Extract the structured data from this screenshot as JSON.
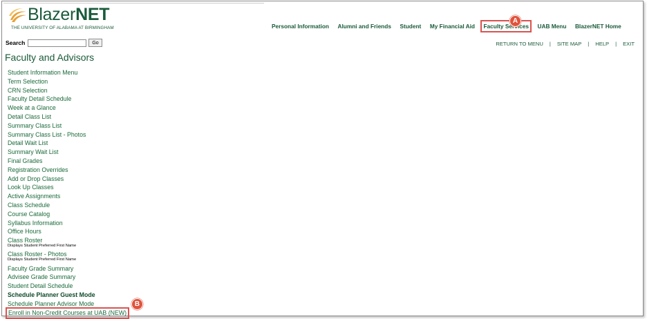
{
  "header": {
    "logo_blazer": "Blazer",
    "logo_net": "NET",
    "logo_sub": "THE UNIVERSITY OF ALABAMA AT BIRMINGHAM",
    "nav": [
      {
        "label": "Personal Information"
      },
      {
        "label": "Alumni and Friends"
      },
      {
        "label": "Student"
      },
      {
        "label": "My Financial Aid"
      },
      {
        "label": "Faculty Services"
      },
      {
        "label": "UAB Menu"
      },
      {
        "label": "BlazerNET Home"
      }
    ],
    "active_nav": "Faculty Services"
  },
  "search": {
    "label": "Search",
    "value": "",
    "go_label": "Go"
  },
  "utility_links": {
    "return": "RETURN TO MENU",
    "sitemap": "SITE MAP",
    "help": "HELP",
    "exit": "EXIT",
    "separator": "|"
  },
  "page": {
    "title": "Faculty and Advisors"
  },
  "menu": [
    {
      "label": "Student Information Menu"
    },
    {
      "label": "Term Selection"
    },
    {
      "label": "CRN Selection"
    },
    {
      "label": "Faculty Detail Schedule"
    },
    {
      "label": "Week at a Glance"
    },
    {
      "label": "Detail Class List"
    },
    {
      "label": "Summary Class List"
    },
    {
      "label": "Summary Class List - Photos"
    },
    {
      "label": "Detail Wait List"
    },
    {
      "label": "Summary Wait List"
    },
    {
      "label": "Final Grades"
    },
    {
      "label": "Registration Overrides"
    },
    {
      "label": "Add or Drop Classes"
    },
    {
      "label": "Look Up Classes"
    },
    {
      "label": "Active Assignments"
    },
    {
      "label": "Class Schedule"
    },
    {
      "label": "Course Catalog"
    },
    {
      "label": "Syllabus Information"
    },
    {
      "label": "Office Hours"
    },
    {
      "label": "Class Roster",
      "sub": "Displays Student Preferred First Name"
    },
    {
      "label": "Class Roster - Photos",
      "sub": "Displays Student Preferred First Name"
    },
    {
      "label": "Faculty Grade Summary"
    },
    {
      "label": "Advisee Grade Summary"
    },
    {
      "label": "Student Detail Schedule"
    },
    {
      "label": "Schedule Planner Guest Mode",
      "bold": true
    },
    {
      "label": "Schedule Planner Advisor Mode"
    },
    {
      "label": "Enroll in Non-Credit Courses at UAB (NEW)",
      "highlight": true
    }
  ],
  "annotations": {
    "a": "A",
    "b": "B",
    "color": "#e0533d"
  },
  "colors": {
    "brand_green": "#1a5a3a",
    "link_green": "#1a6a3a",
    "logo_gold": "#e8a23a",
    "highlight_red": "#d9534f"
  }
}
